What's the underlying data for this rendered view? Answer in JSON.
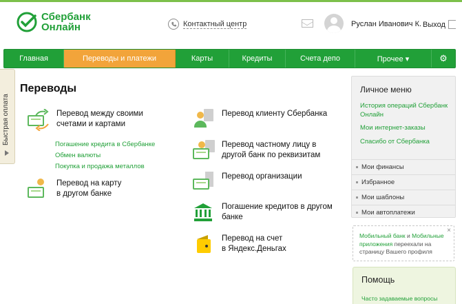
{
  "brand": {
    "line1": "Сбербанк",
    "line2": "Онлайн",
    "color": "#21a038"
  },
  "header": {
    "contact_label": "Контактный центр",
    "user_name": "Руслан Иванович К.",
    "logout_label": "Выход"
  },
  "nav": {
    "items": [
      {
        "label": "Главная"
      },
      {
        "label": "Переводы и платежи"
      },
      {
        "label": "Карты"
      },
      {
        "label": "Кредиты"
      },
      {
        "label": "Счета депо"
      },
      {
        "label": "Прочее ▾"
      },
      {
        "label": "⚙"
      }
    ],
    "active_color": "#f2a43a"
  },
  "side_tab": {
    "label": "Быстрая оплата"
  },
  "main": {
    "title": "Переводы",
    "ops": [
      {
        "line1": "Перевод между своими",
        "line2": "счетами и картами"
      },
      {
        "line1": "Перевод на карту",
        "line2": "в другом банке"
      },
      {
        "line1": "Перевод клиенту Сбербанка",
        "line2": ""
      },
      {
        "line1": "Перевод частному лицу в",
        "line2": "другой банк по реквизитам"
      },
      {
        "line1": "Перевод организации",
        "line2": ""
      },
      {
        "line1": "Погашение кредитов в другом",
        "line2": "банке"
      },
      {
        "line1": "Перевод на счет",
        "line2": "в Яндекс.Деньгах"
      }
    ],
    "sublinks": [
      "Погашение кредита в Сбербанке",
      "Обмен валюты",
      "Покупка и продажа металлов"
    ]
  },
  "personal_menu": {
    "title": "Личное меню",
    "links": [
      "История операций Сбербанк Онлайн",
      "Мои интернет-заказы",
      "Спасибо от Сбербанка"
    ],
    "sections": [
      "Мои финансы",
      "Избранное",
      "Мои шаблоны",
      "Мои автоплатежи"
    ]
  },
  "notice": {
    "link1": "Мобильный банк",
    "and": " и ",
    "link2": "Мобильные приложения",
    "rest": " переехали на страницу Вашего профиля",
    "close": "×"
  },
  "help": {
    "title": "Помощь",
    "link": "Часто задаваемые вопросы"
  }
}
